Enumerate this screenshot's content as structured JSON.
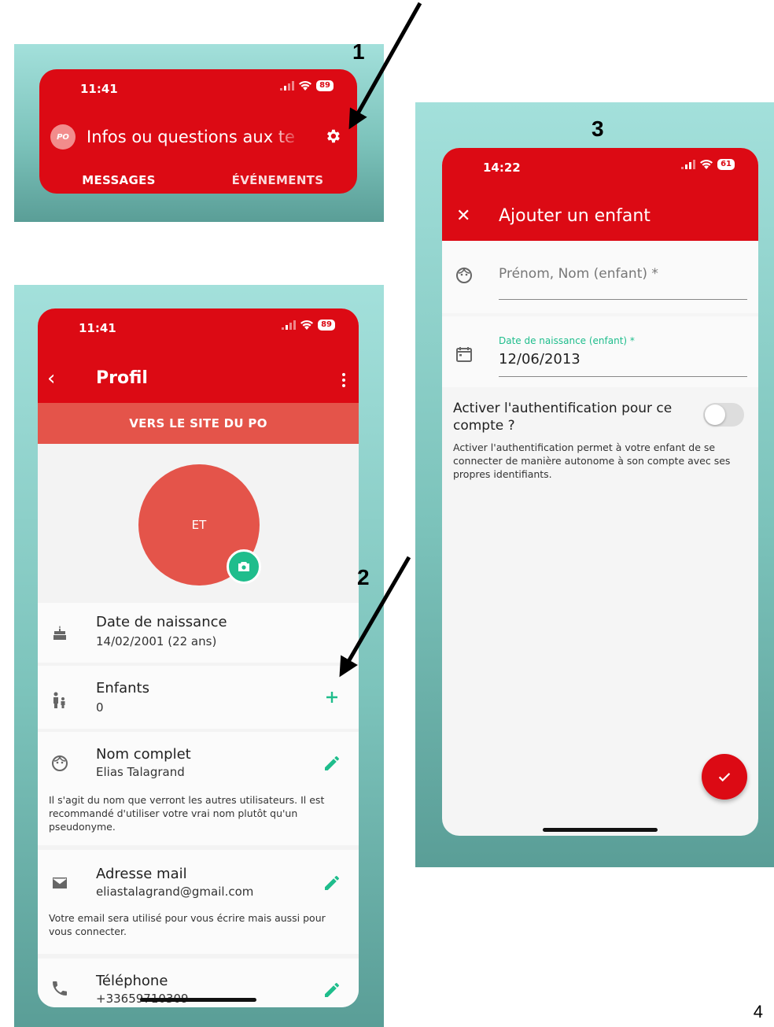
{
  "markers": {
    "one": "1",
    "two": "2",
    "three": "3"
  },
  "page_number": "4",
  "screen1": {
    "status_time": "11:41",
    "battery": "89",
    "logo_text": "PO",
    "title": "Infos ou questions aux te",
    "tabs": [
      "MESSAGES",
      "ÉVÉNEMENTS"
    ]
  },
  "screen2": {
    "status_time": "11:41",
    "battery": "89",
    "title": "Profil",
    "site_button": "VERS LE SITE DU PO",
    "avatar_initials": "ET",
    "birthdate": {
      "label": "Date de naissance",
      "value": "14/02/2001 (22 ans)"
    },
    "children": {
      "label": "Enfants",
      "value": "0"
    },
    "full_name": {
      "label": "Nom complet",
      "value": "Elias Talagrand",
      "note": "Il s'agit du nom que verront les autres utilisateurs. Il est recommandé d'utiliser votre vrai nom plutôt qu'un pseudonyme."
    },
    "email": {
      "label": "Adresse mail",
      "value": "eliastalagrand@gmail.com",
      "note": "Votre email sera utilisé pour vous écrire mais aussi pour vous connecter."
    },
    "phone": {
      "label": "Téléphone",
      "value": "+33659710309"
    }
  },
  "screen3": {
    "status_time": "14:22",
    "battery": "61",
    "title": "Ajouter un enfant",
    "name_placeholder": "Prénom, Nom (enfant) *",
    "birth_label": "Date de naissance (enfant) *",
    "birth_value": "12/06/2013",
    "auth_title": "Activer l'authentification pour ce compte ?",
    "auth_description": "Activer l'authentification permet à votre enfant de se connecter de manière autonome à son compte avec ses propres identifiants.",
    "auth_enabled": false
  },
  "colors": {
    "brand_red": "#dc0a14",
    "accent_green": "#1fbd8c",
    "avatar_red": "#e4544a"
  }
}
